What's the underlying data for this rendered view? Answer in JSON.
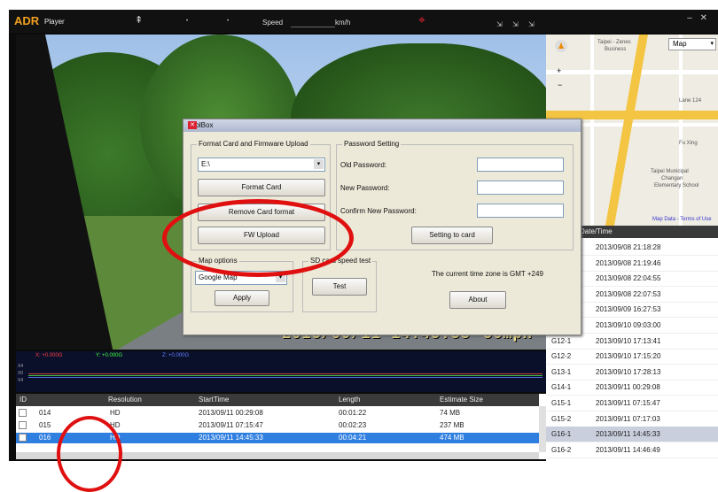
{
  "app": {
    "brand": "ADR",
    "subtitle": "Player",
    "speed_label": "Speed",
    "speed_unit": "km/h"
  },
  "video": {
    "timestamp": "2013/09/11 14:45:33",
    "speed": "36mph"
  },
  "graph": {
    "x_label": "X: +0.000G",
    "y_label": "Y: +0.000G",
    "z_label": "Z: +0.000G"
  },
  "table": {
    "headers": [
      "ID",
      "Resolution",
      "StartTime",
      "Length",
      "Estimate Size"
    ],
    "rows": [
      {
        "id": "014",
        "resolution": "HD",
        "start": "2013/09/11 00:29:08",
        "length": "00:01:22",
        "size": "74 MB"
      },
      {
        "id": "015",
        "resolution": "HD",
        "start": "2013/09/11 07:15:47",
        "length": "00:02:23",
        "size": "237 MB"
      },
      {
        "id": "016",
        "resolution": "HD",
        "start": "2013/09/11 14:45:33",
        "length": "00:04:21",
        "size": "474 MB"
      }
    ]
  },
  "map": {
    "type_select": "Map",
    "labels": [
      "Taipei - Zenes",
      "Business",
      "Lane 124",
      "Fu Xing",
      "Taipei Municipal",
      "Changan",
      "Elementary School"
    ],
    "footer": "Map Data - Terms of Use"
  },
  "list": {
    "header": "Date/Time",
    "rows": [
      {
        "id": "",
        "time": "2013/09/08 21:18:28"
      },
      {
        "id": "",
        "time": "2013/09/08 21:19:46"
      },
      {
        "id": "",
        "time": "2013/09/08 22:04:55"
      },
      {
        "id": "",
        "time": "2013/09/08 22:07:53"
      },
      {
        "id": "",
        "time": "2013/09/09 16:27:53"
      },
      {
        "id": "",
        "time": "2013/09/10 09:03:00"
      },
      {
        "id": "G12-1",
        "time": "2013/09/10 17:13:41"
      },
      {
        "id": "G12-2",
        "time": "2013/09/10 17:15:20"
      },
      {
        "id": "G13-1",
        "time": "2013/09/10 17:28:13"
      },
      {
        "id": "G14-1",
        "time": "2013/09/11 00:29:08"
      },
      {
        "id": "G15-1",
        "time": "2013/09/11 07:15:47"
      },
      {
        "id": "G15-2",
        "time": "2013/09/11 07:17:03"
      },
      {
        "id": "G16-1",
        "time": "2013/09/11 14:45:33"
      },
      {
        "id": "G16-2",
        "time": "2013/09/11 14:46:49"
      }
    ]
  },
  "toolbox": {
    "title": "ToolBox",
    "format_group": "Format Card and Firmware Upload",
    "drive_value": "E:\\",
    "format_button": "Format Card",
    "remove_button": "Remove Card format",
    "fw_button": "FW Upload",
    "password_group": "Password Setting",
    "old_password": "Old Password:",
    "new_password": "New Password:",
    "confirm_password": "Confirm New Password:",
    "setting_button": "Setting to card",
    "map_group": "Map options",
    "map_value": "Google Map",
    "apply_button": "Apply",
    "sd_group": "SD card speed test",
    "test_button": "Test",
    "timezone_text": "The current time zone is GMT +249",
    "about_button": "About"
  }
}
